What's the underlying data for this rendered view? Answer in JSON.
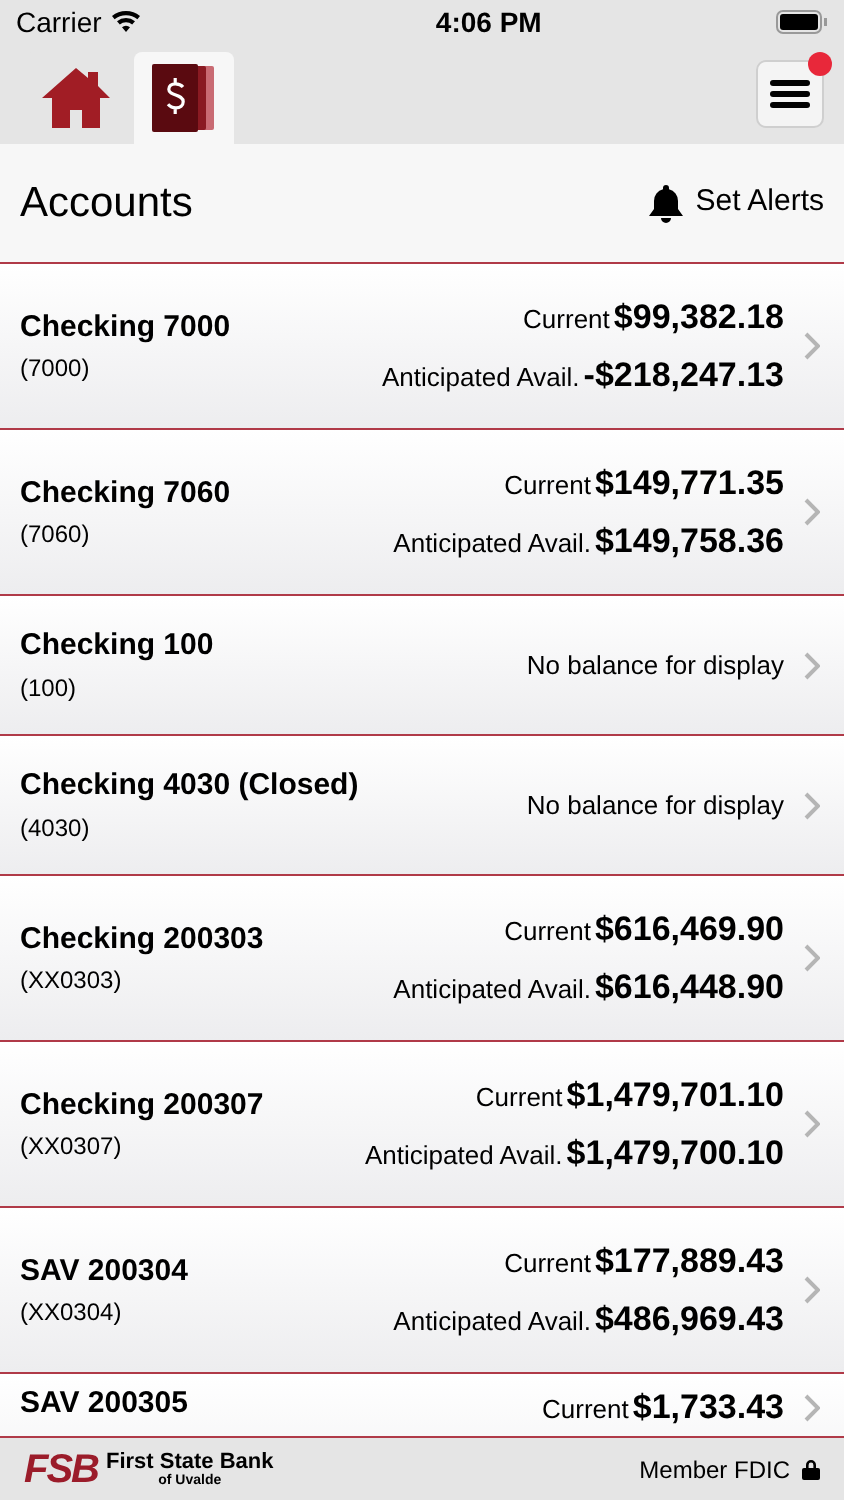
{
  "status_bar": {
    "carrier": "Carrier",
    "time": "4:06 PM"
  },
  "tabs": [
    {
      "kind": "home",
      "selected": false
    },
    {
      "kind": "accounts",
      "selected": true
    }
  ],
  "menu": {
    "has_notification": true
  },
  "header": {
    "title": "Accounts",
    "alerts_label": "Set Alerts"
  },
  "accounts": [
    {
      "name": "Checking 7000",
      "number": "(7000)",
      "current_label": "Current",
      "current": "$99,382.18",
      "anticipated_label": "Anticipated Avail.",
      "anticipated": "-$218,247.13"
    },
    {
      "name": "Checking 7060",
      "number": "(7060)",
      "current_label": "Current",
      "current": "$149,771.35",
      "anticipated_label": "Anticipated Avail.",
      "anticipated": "$149,758.36"
    },
    {
      "name": "Checking 100",
      "number": "(100)",
      "no_balance": "No balance for display"
    },
    {
      "name": "Checking 4030 (Closed)",
      "number": "(4030)",
      "no_balance": "No balance for display"
    },
    {
      "name": "Checking 200303",
      "number": "(XX0303)",
      "current_label": "Current",
      "current": "$616,469.90",
      "anticipated_label": "Anticipated Avail.",
      "anticipated": "$616,448.90"
    },
    {
      "name": "Checking 200307",
      "number": "(XX0307)",
      "current_label": "Current",
      "current": "$1,479,701.10",
      "anticipated_label": "Anticipated Avail.",
      "anticipated": "$1,479,700.10"
    },
    {
      "name": "SAV 200304",
      "number": "(XX0304)",
      "current_label": "Current",
      "current": "$177,889.43",
      "anticipated_label": "Anticipated Avail.",
      "anticipated": "$486,969.43"
    },
    {
      "name": "SAV 200305",
      "current_label": "Current",
      "current": "$1,733.43"
    }
  ],
  "footer": {
    "logo_mark": "FSB",
    "bank_name": "First State Bank",
    "bank_sub": "of Uvalde",
    "fdic": "Member FDIC"
  }
}
